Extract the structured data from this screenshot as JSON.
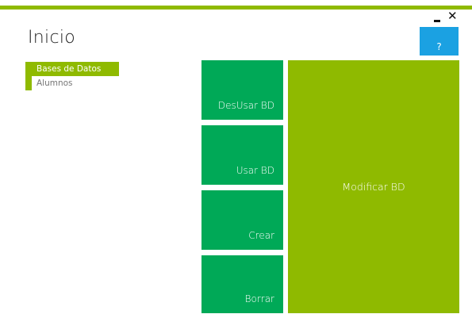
{
  "window": {
    "minimize_icon": "minimize-icon",
    "close_icon": "close-icon",
    "close_glyph": "✕"
  },
  "header": {
    "title": "Inicio",
    "help_label": "?"
  },
  "nav": {
    "items": [
      {
        "label": "Bases de Datos",
        "active": true
      },
      {
        "label": "Alumnos",
        "active": false
      }
    ]
  },
  "tiles": {
    "desusar": "DesUsar BD",
    "usar": "Usar BD",
    "crear": "Crear",
    "borrar": "Borrar",
    "modificar": "Modificar BD"
  },
  "colors": {
    "accent_green": "#8fba00",
    "tile_green": "#00a957",
    "help_blue": "#1ba1e2"
  }
}
